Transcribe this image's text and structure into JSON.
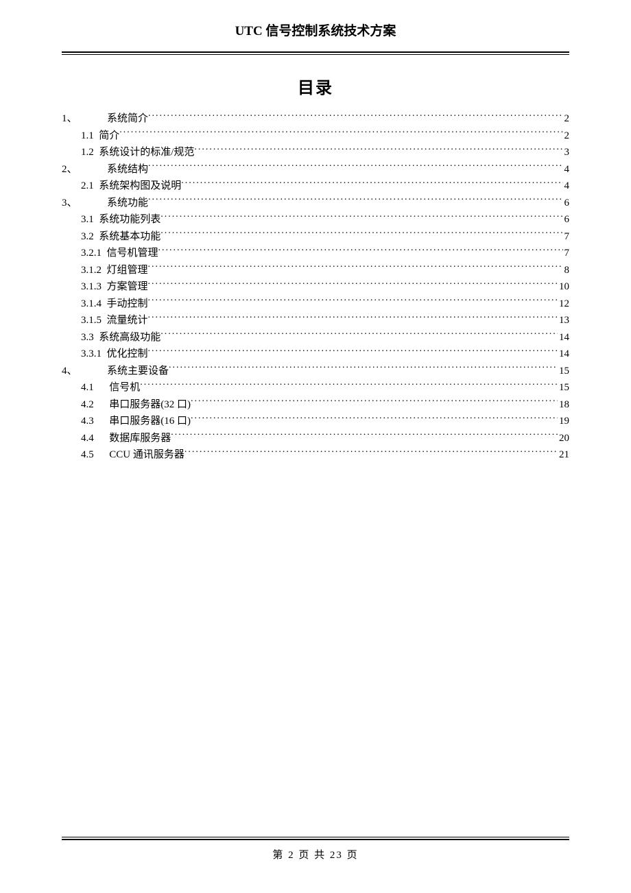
{
  "header": {
    "title": "UTC 信号控制系统技术方案"
  },
  "toc": {
    "title": "目录",
    "entries": [
      {
        "num": "1、",
        "label": "系统简介",
        "page": "2",
        "level": 0
      },
      {
        "num": "1.1",
        "label": "简介",
        "page": "2",
        "level": 1
      },
      {
        "num": "1.2",
        "label": "系统设计的标准/规范",
        "page": "3",
        "level": 1
      },
      {
        "num": "2、",
        "label": "系统结构",
        "page": "4",
        "level": 0
      },
      {
        "num": "2.1",
        "label": "系统架构图及说明",
        "page": "4",
        "level": 1
      },
      {
        "num": "3、",
        "label": "系统功能",
        "page": "6",
        "level": 0
      },
      {
        "num": "3.1",
        "label": "系统功能列表",
        "page": "6",
        "level": 1
      },
      {
        "num": "3.2",
        "label": "系统基本功能",
        "page": "7",
        "level": 1
      },
      {
        "num": "3.2.1",
        "label": "信号机管理",
        "page": "7",
        "level": 1
      },
      {
        "num": "3.1.2",
        "label": "灯组管理",
        "page": "8",
        "level": 1
      },
      {
        "num": "3.1.3",
        "label": "方案管理",
        "page": "10",
        "level": 1
      },
      {
        "num": "3.1.4",
        "label": "手动控制",
        "page": "12",
        "level": 1
      },
      {
        "num": "3.1.5",
        "label": "流量统计",
        "page": "13",
        "level": 1
      },
      {
        "num": "3.3",
        "label": "系统高级功能",
        "page": "14",
        "level": 1
      },
      {
        "num": "3.3.1",
        "label": "优化控制",
        "page": "14",
        "level": 1
      },
      {
        "num": "4、",
        "label": "系统主要设备",
        "page": "15",
        "level": 0
      },
      {
        "num": "4.1",
        "label": "信号机",
        "page": "15",
        "level": 2
      },
      {
        "num": "4.2",
        "label": "串口服务器(32 口)",
        "page": "18",
        "level": 2
      },
      {
        "num": "4.3",
        "label": "串口服务器(16 口)",
        "page": "19",
        "level": 2
      },
      {
        "num": "4.4",
        "label": "数据库服务器",
        "page": "20",
        "level": 2
      },
      {
        "num": "4.5",
        "label": "CCU 通讯服务器",
        "page": "21",
        "level": 2
      }
    ]
  },
  "footer": {
    "text": "第 2 页  共 23 页"
  }
}
